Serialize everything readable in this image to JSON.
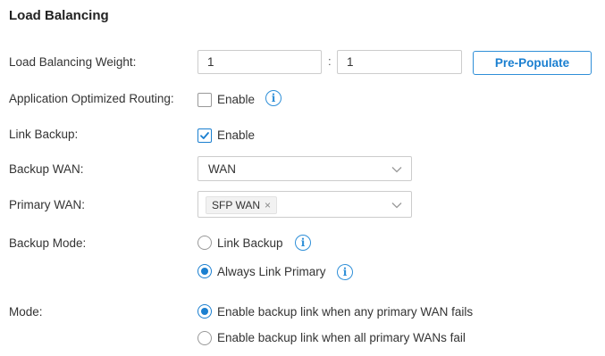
{
  "section_title": "Load Balancing",
  "weight": {
    "label": "Load Balancing Weight:",
    "value1": "1",
    "separator": ":",
    "value2": "1",
    "button": "Pre-Populate"
  },
  "app_routing": {
    "label": "Application Optimized Routing:",
    "option": "Enable",
    "checked": false,
    "info_icon": "info-icon"
  },
  "link_backup": {
    "label": "Link Backup:",
    "option": "Enable",
    "checked": true
  },
  "backup_wan": {
    "label": "Backup WAN:",
    "selected": "WAN"
  },
  "primary_wan": {
    "label": "Primary WAN:",
    "tags": [
      "SFP WAN"
    ],
    "tag_remove": "×"
  },
  "backup_mode": {
    "label": "Backup Mode:",
    "options": [
      {
        "label": "Link Backup",
        "selected": false
      },
      {
        "label": "Always Link Primary",
        "selected": true
      }
    ]
  },
  "mode": {
    "label": "Mode:",
    "options": [
      {
        "label": "Enable backup link when any primary WAN fails",
        "selected": true
      },
      {
        "label": "Enable backup link when all primary WANs fail",
        "selected": false
      }
    ]
  },
  "colors": {
    "accent": "#1a7fd0",
    "border": "#cccccc",
    "text": "#333333"
  }
}
